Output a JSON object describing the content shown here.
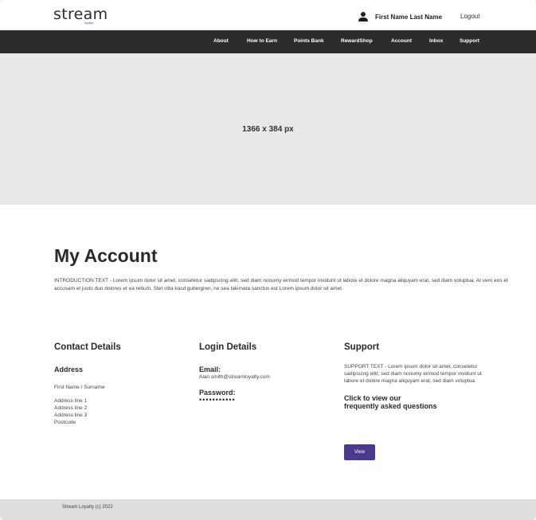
{
  "header": {
    "logo": "stream",
    "logo_sub": "loyalty",
    "user_name": "First Name Last Name",
    "logout_label": "Logout"
  },
  "nav": {
    "items": [
      "About",
      "How to Earn",
      "Points Bank",
      "RewardShop",
      "Account",
      "Inbox",
      "Support"
    ]
  },
  "hero": {
    "label": "1366 x 384 px"
  },
  "main": {
    "title": "My Account",
    "intro": "INTRODUCTION TEXT - Lorem ipsum dolor sit amet, consetetur sadipscing elitr, sed diam nonumy eirmod tempor invidunt ut labore et dolore magna aliquyam erat, sed diam voluptua. At vero eos et accusam et justo duo dolores et ea rebum. Stet clita kasd gubergren, no sea takimata sanctus est Lorem ipsum dolor sit amet."
  },
  "contact": {
    "heading": "Contact Details",
    "address_heading": "Address",
    "name": "First Name / Surname",
    "address_lines": [
      "Address line 1",
      "Address line 2",
      "Address line 3",
      "Postcode"
    ]
  },
  "login": {
    "heading": "Login Details",
    "email_label": "Email:",
    "email_value": "Alan.smith@streamloyalty.com",
    "password_label": "Password:",
    "password_value": "•••••••••••"
  },
  "support": {
    "heading": "Support",
    "text": "SUPPORT TEXT - Lorem ipsum dolor sit amet, consetetur sadipscing elitr, sed diam nonumy eirmod tempor invidunt ut labore et dolore magna aliquyam erat, sed diam voluptua.",
    "faq_line1": "Click to view our",
    "faq_line2": "frequently asked questions",
    "view_label": "View"
  },
  "footer": {
    "text": "Stream Loyalty (c) 2022"
  },
  "colors": {
    "nav_bg": "#2c2c2c",
    "hero_bg": "#e8e8e8",
    "button": "#4b3a8c",
    "footer_bg": "#dedede"
  }
}
